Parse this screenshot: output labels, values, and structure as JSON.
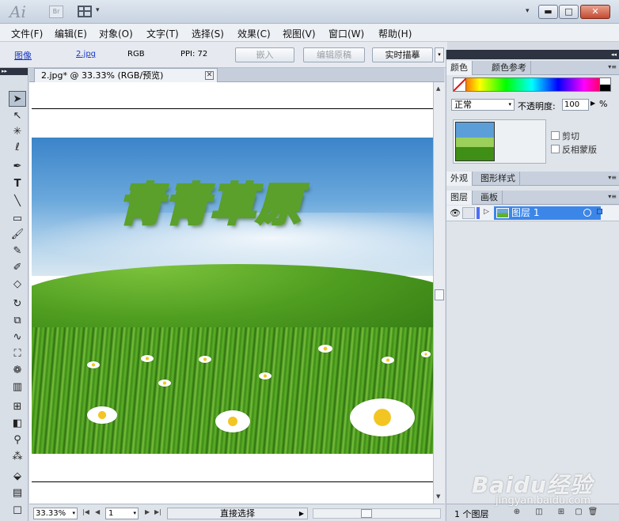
{
  "titlebar": {
    "logo": "Ai",
    "bridge_label": "Br",
    "arrange_arrow": "▾",
    "workspace_arrow": "▾",
    "minimize": "▬",
    "maximize": "□",
    "close": "✕"
  },
  "menu": {
    "items": [
      "文件(F)",
      "编辑(E)",
      "对象(O)",
      "文字(T)",
      "选择(S)",
      "效果(C)",
      "视图(V)",
      "窗口(W)",
      "帮助(H)"
    ]
  },
  "controlbar": {
    "type_label": "图像",
    "file_link": "2.jpg",
    "color_mode": "RGB",
    "ppi": "PPI: 72",
    "embed_button": "嵌入",
    "edit_original_button": "编辑原稿",
    "live_trace_button": "实时描摹",
    "dropdown_arrow": "▾"
  },
  "document": {
    "tab_title": "2.jpg* @ 33.33% (RGB/预览)",
    "tab_close": "✕",
    "headline": "青青草原"
  },
  "statusbar": {
    "zoom": "33.33%",
    "page": "1",
    "current_tool": "直接选择",
    "dd": "▾",
    "first": "|◀",
    "prev": "◀",
    "next": "▶",
    "last": "▶|",
    "status_arrow": "▶",
    "left_arr": "◀",
    "right_arr": "▶"
  },
  "panels": {
    "grip_arrows": "◂◂",
    "color_tabs": [
      "颜色",
      "颜色参考"
    ],
    "blend_mode": "正常",
    "opacity_label": "不透明度:",
    "opacity_value": "100",
    "opacity_unit": "%",
    "clip_label": "剪切",
    "invert_mask_label": "反相蒙版",
    "appearance_tabs": [
      "外观",
      "图形样式"
    ],
    "layer_tabs": [
      "图层",
      "画板"
    ],
    "layer_name": "图层 1",
    "layer_count": "1 个图层",
    "menu_glyph": "▾≡"
  },
  "watermark": {
    "brand": "Baidu经验",
    "sub": "jingyan.baidu.com"
  },
  "colors": {
    "selection_blue": "#3c86e8",
    "headline_stroke": "#5aa02a"
  },
  "tools": [
    "selection-tool",
    "direct-selection-tool",
    "magic-wand-tool",
    "lasso-tool",
    "pen-tool",
    "type-tool",
    "line-segment-tool",
    "rectangle-tool",
    "paintbrush-tool",
    "pencil-tool",
    "blob-brush-tool",
    "eraser-tool",
    "rotate-tool",
    "scale-tool",
    "warp-tool",
    "free-transform-tool",
    "symbol-sprayer-tool",
    "column-graph-tool",
    "mesh-tool",
    "gradient-tool",
    "eyedropper-tool",
    "blend-tool",
    "live-paint-bucket-tool",
    "artboard-tool"
  ]
}
